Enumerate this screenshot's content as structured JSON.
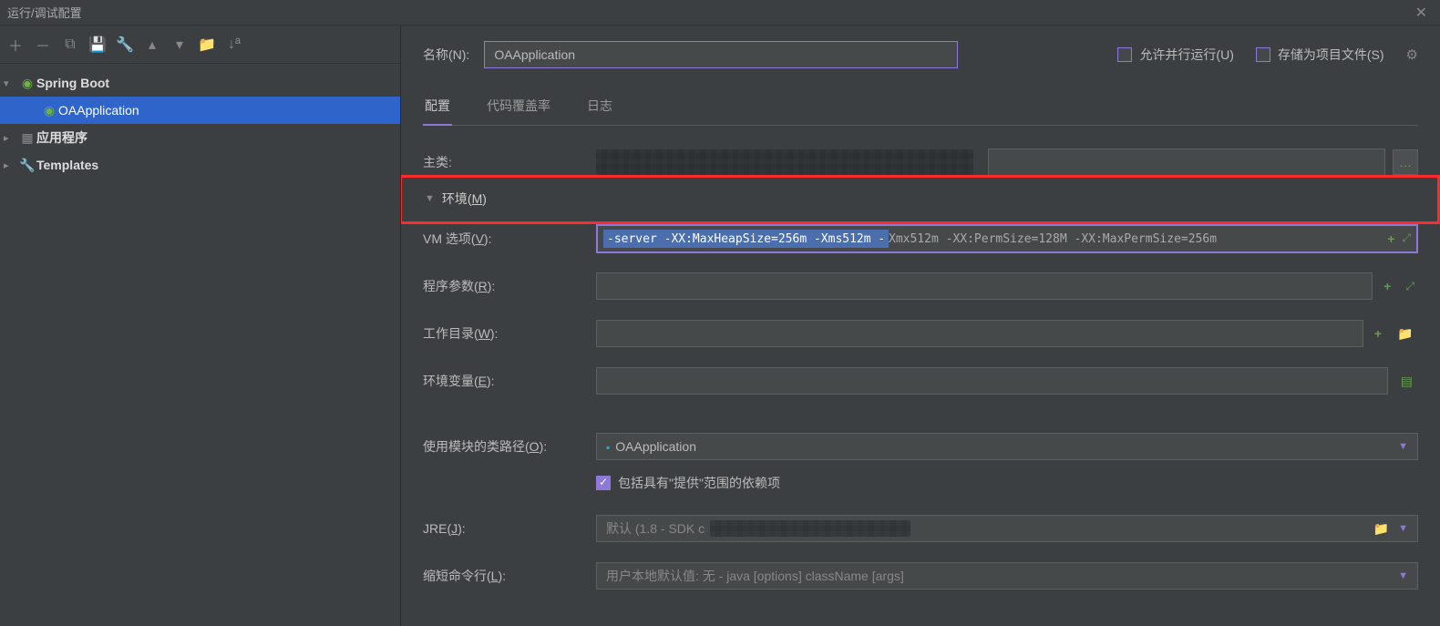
{
  "window": {
    "title": "运行/调试配置"
  },
  "sidebar": {
    "items": [
      {
        "label": "Spring Boot",
        "icon": "springboot"
      },
      {
        "label": "OAApplication",
        "icon": "springboot",
        "selected": true
      },
      {
        "label": "应用程序",
        "icon": "app"
      },
      {
        "label": "Templates",
        "icon": "wrench"
      }
    ]
  },
  "header": {
    "name_label": "名称(N):",
    "name_value": "OAApplication",
    "allow_parallel": "允许并行运行(U)",
    "store_project_file": "存储为项目文件(S)"
  },
  "tabs": [
    {
      "label": "配置",
      "active": true
    },
    {
      "label": "代码覆盖率"
    },
    {
      "label": "日志"
    }
  ],
  "form": {
    "main_class_label": "主类:",
    "env_section": "环境(M)",
    "vm_label": "VM 选项(V):",
    "vm_value_selected": "-server -XX:MaxHeapSize=256m -Xms512m -",
    "vm_value_rest": "Xmx512m -XX:PermSize=128M -XX:MaxPermSize=256m",
    "program_args_label": "程序参数(R):",
    "program_args_value": "",
    "working_dir_label": "工作目录(W):",
    "working_dir_value": "",
    "env_vars_label": "环境变量(E):",
    "env_vars_value": "",
    "classpath_label": "使用模块的类路径(O):",
    "classpath_value": "OAApplication",
    "include_provided": "包括具有\"提供\"范围的依赖项",
    "jre_label": "JRE(J):",
    "jre_value": "默认 (1.8 - SDK c",
    "shorten_label": "缩短命令行(L):",
    "shorten_value": "用户本地默认值: 无 - java [options] className [args]"
  }
}
